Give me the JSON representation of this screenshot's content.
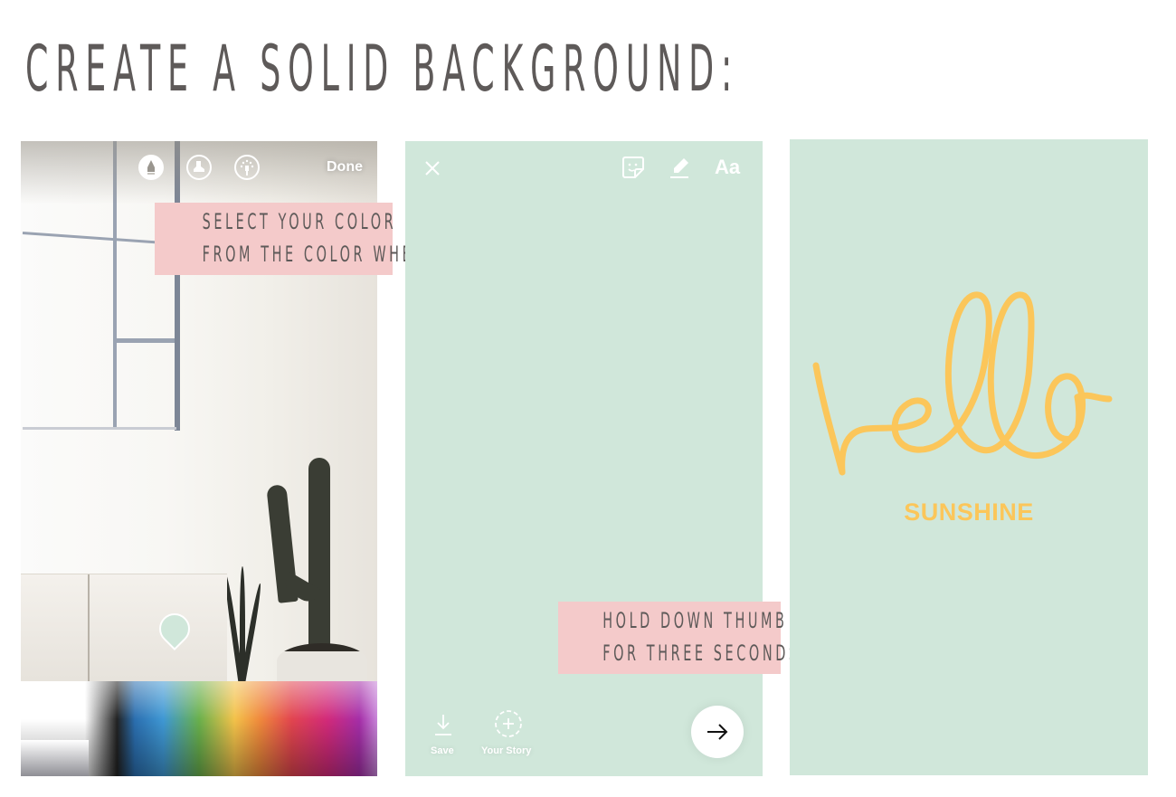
{
  "page": {
    "title": "CREATE A SOLID BACKGROUND:"
  },
  "panel1": {
    "toolbar": {
      "icons": [
        "marker-pen-icon",
        "highlighter-icon",
        "neon-brush-icon"
      ],
      "done_label": "Done"
    },
    "annotation": {
      "line1": "SELECT YOUR COLOR",
      "line2": "FROM THE COLOR WHEEL"
    },
    "selected_color": "#d0e7da"
  },
  "panel2": {
    "background_color": "#d0e7da",
    "toolbar": {
      "close_icon": "close-icon",
      "sticker_icon": "sticker-icon",
      "draw_icon": "draw-icon",
      "text_label": "Aa"
    },
    "annotation": {
      "line1": "HOLD DOWN THUMB",
      "line2": "FOR THREE SECONDS"
    },
    "bottom": {
      "save_label": "Save",
      "your_story_label": "Your Story",
      "next_icon": "arrow-right-icon"
    }
  },
  "panel3": {
    "background_color": "#d0e7da",
    "script_text": "hello",
    "caption": "SUNSHINE",
    "text_color": "#fbc65a"
  },
  "colors": {
    "title_gray": "#5e5a59",
    "annotation_pink": "#f4caca",
    "mint": "#d0e7da",
    "yellow": "#fbc65a"
  }
}
